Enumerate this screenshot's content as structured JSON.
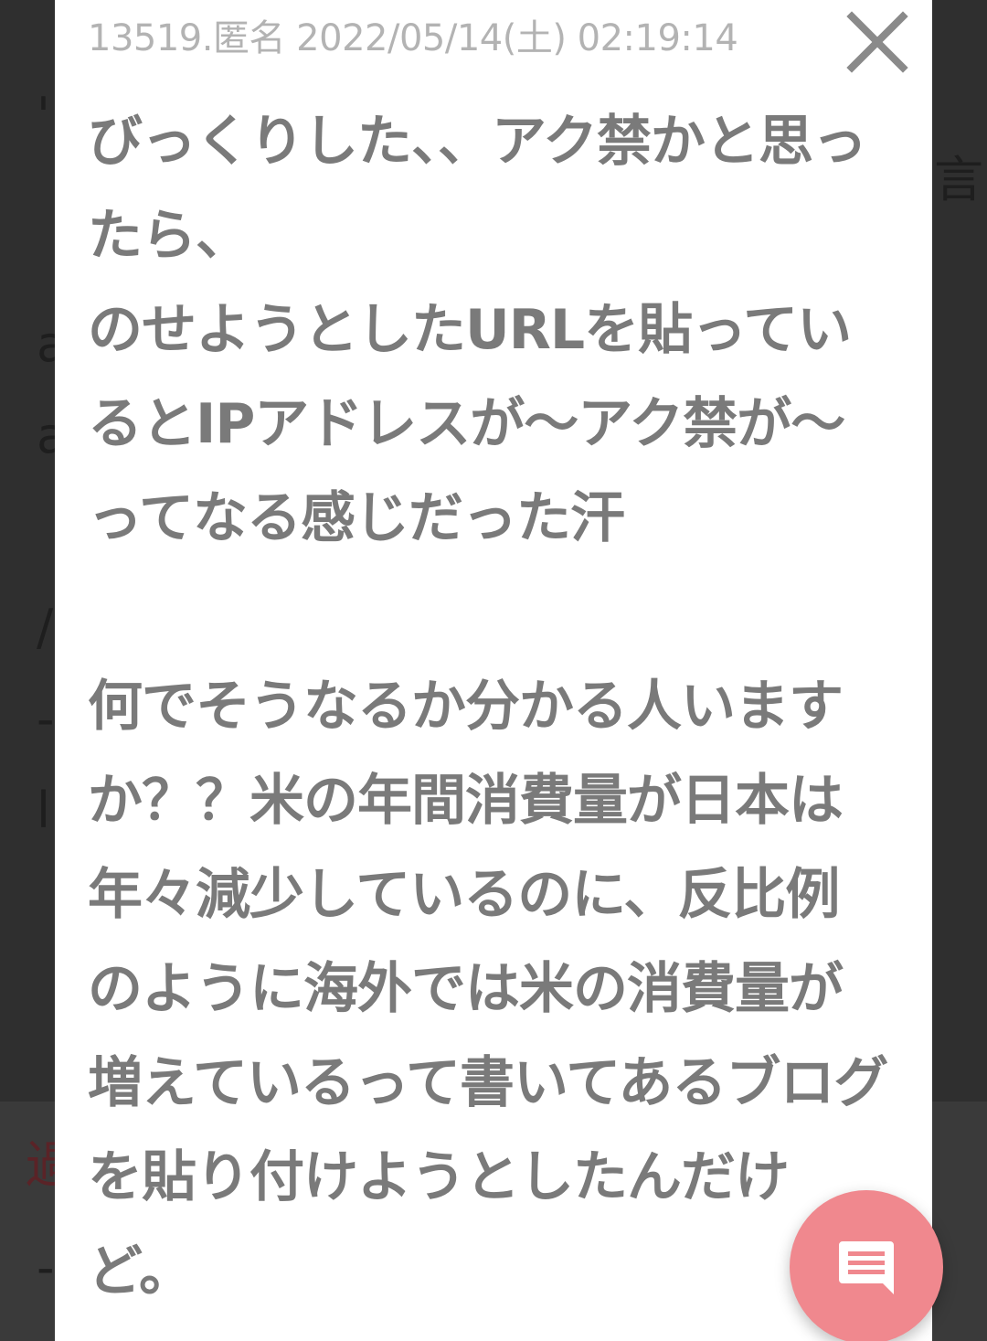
{
  "post": {
    "header": "13519.匿名 2022/05/14(土) 02:19:14",
    "body": "びっくりした、、アク禁かと思ったら、\nのせようとしたURLを貼っているとIPアドレスが〜アク禁が〜ってなる感じだった汗\n\n何でそうなるか分かる人いますか？？米の年間消費量が日本は年々減少しているのに、反比例のように海外では米の消費量が増えているって書いてあるブログを貼り付けようとしたんだけど。"
  },
  "icons": {
    "close": "close-icon",
    "comment": "comment-icon"
  },
  "colors": {
    "fab_background": "#f0888e",
    "body_text": "#7a7a7a",
    "header_text": "#b3b3b3"
  }
}
